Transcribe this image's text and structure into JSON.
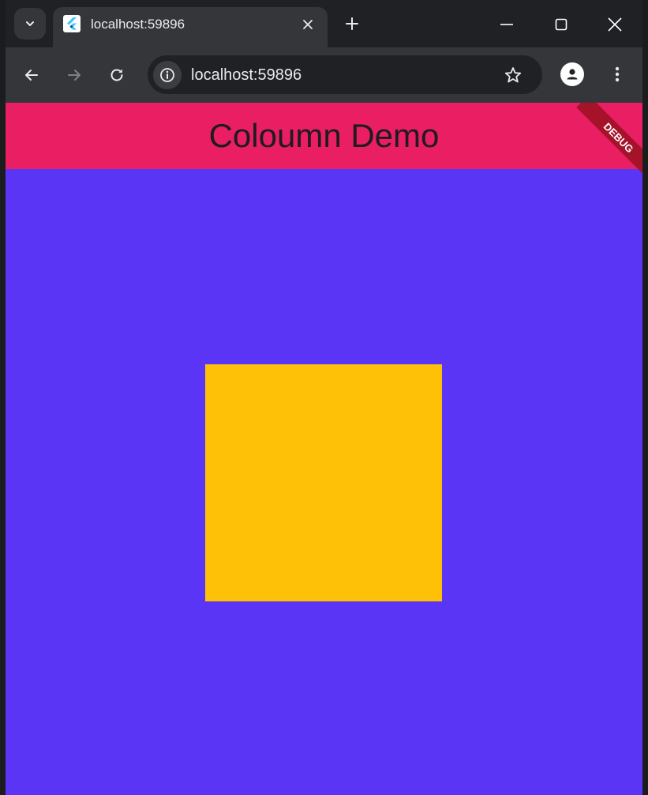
{
  "browser": {
    "tab": {
      "title": "localhost:59896"
    },
    "address_bar": {
      "url": "localhost:59896"
    },
    "icons": {
      "tab_search": "chevron-down-icon",
      "favicon": "flutter-icon",
      "close_tab": "close-icon",
      "new_tab": "plus-icon",
      "minimize": "minimize-icon",
      "maximize": "maximize-icon",
      "close_window": "close-icon",
      "back": "arrow-left-icon",
      "forward": "arrow-right-icon",
      "reload": "reload-icon",
      "site_info": "info-icon",
      "bookmark": "star-icon",
      "profile": "person-icon",
      "menu": "kebab-menu-icon"
    }
  },
  "app": {
    "appbar": {
      "title": "Coloumn Demo",
      "color": "#e91e63"
    },
    "body": {
      "background_color": "#5a35f5"
    },
    "square": {
      "color": "#ffc107"
    },
    "debug_banner": {
      "label": "DEBUG"
    }
  }
}
